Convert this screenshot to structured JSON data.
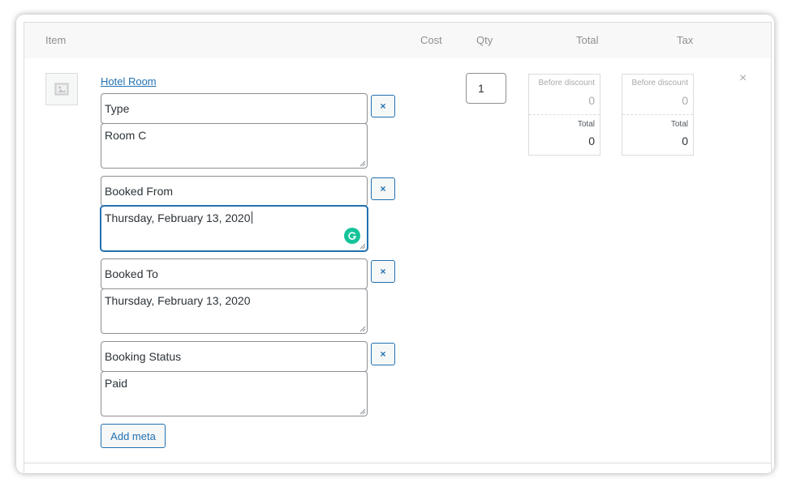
{
  "table_header": {
    "item": "Item",
    "cost": "Cost",
    "qty": "Qty",
    "total": "Total",
    "tax": "Tax"
  },
  "line_item": {
    "name": "Hotel Room",
    "thumbnail_icon": "image-placeholder-icon",
    "quantity": "1",
    "meta": [
      {
        "key": "Type",
        "value": "Room C"
      },
      {
        "key": "Booked From",
        "value": "Thursday, February 13, 2020"
      },
      {
        "key": "Booked To",
        "value": "Thursday, February 13, 2020"
      },
      {
        "key": "Booking Status",
        "value": "Paid"
      }
    ],
    "meta_remove_label": "×",
    "add_meta_label": "Add meta",
    "total_box": {
      "before_discount_label": "Before discount",
      "before_discount_value": "0",
      "total_label": "Total",
      "total_value": "0"
    },
    "tax_box": {
      "before_discount_label": "Before discount",
      "before_discount_value": "0",
      "total_label": "Total",
      "total_value": "0"
    },
    "remove_item_label": "×"
  },
  "colors": {
    "accent": "#2271b1",
    "grammarly": "#15c39a",
    "header_bg": "#f8f8f8"
  }
}
